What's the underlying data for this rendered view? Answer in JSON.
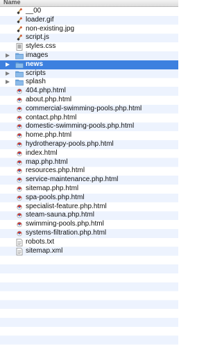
{
  "header": {
    "column_label": "Name"
  },
  "rows": [
    {
      "name": "__00",
      "kind": "script-icon"
    },
    {
      "name": "loader.gif",
      "kind": "script-icon"
    },
    {
      "name": "non-existing.jpg",
      "kind": "script-icon"
    },
    {
      "name": "script.js",
      "kind": "script-icon"
    },
    {
      "name": "styles.css",
      "kind": "css-file-icon"
    },
    {
      "name": "images",
      "kind": "folder-icon",
      "expandable": true
    },
    {
      "name": "news",
      "kind": "folder-icon",
      "expandable": true,
      "selected": true
    },
    {
      "name": "scripts",
      "kind": "folder-icon",
      "expandable": true
    },
    {
      "name": "splash",
      "kind": "folder-icon",
      "expandable": true
    },
    {
      "name": "404.php.html",
      "kind": "html-file-icon"
    },
    {
      "name": "about.php.html",
      "kind": "html-file-icon"
    },
    {
      "name": "commercial-swimming-pools.php.html",
      "kind": "html-file-icon"
    },
    {
      "name": "contact.php.html",
      "kind": "html-file-icon"
    },
    {
      "name": "domestic-swimming-pools.php.html",
      "kind": "html-file-icon"
    },
    {
      "name": "home.php.html",
      "kind": "html-file-icon"
    },
    {
      "name": "hydrotherapy-pools.php.html",
      "kind": "html-file-icon"
    },
    {
      "name": "index.html",
      "kind": "html-file-icon"
    },
    {
      "name": "map.php.html",
      "kind": "html-file-icon"
    },
    {
      "name": "resources.php.html",
      "kind": "html-file-icon"
    },
    {
      "name": "service-maintenance.php.html",
      "kind": "html-file-icon"
    },
    {
      "name": "sitemap.php.html",
      "kind": "html-file-icon"
    },
    {
      "name": "spa-pools.php.html",
      "kind": "html-file-icon"
    },
    {
      "name": "specialist-feature.php.html",
      "kind": "html-file-icon"
    },
    {
      "name": "steam-sauna.php.html",
      "kind": "html-file-icon"
    },
    {
      "name": "swimming-pools.php.html",
      "kind": "html-file-icon"
    },
    {
      "name": "systems-filtration.php.html",
      "kind": "html-file-icon"
    },
    {
      "name": "robots.txt",
      "kind": "text-file-icon"
    },
    {
      "name": "sitemap.xml",
      "kind": "text-file-icon"
    }
  ],
  "colors": {
    "selection": "#3d80df",
    "alternate_row": "#edf3fe",
    "folder": "#6aa4de"
  }
}
